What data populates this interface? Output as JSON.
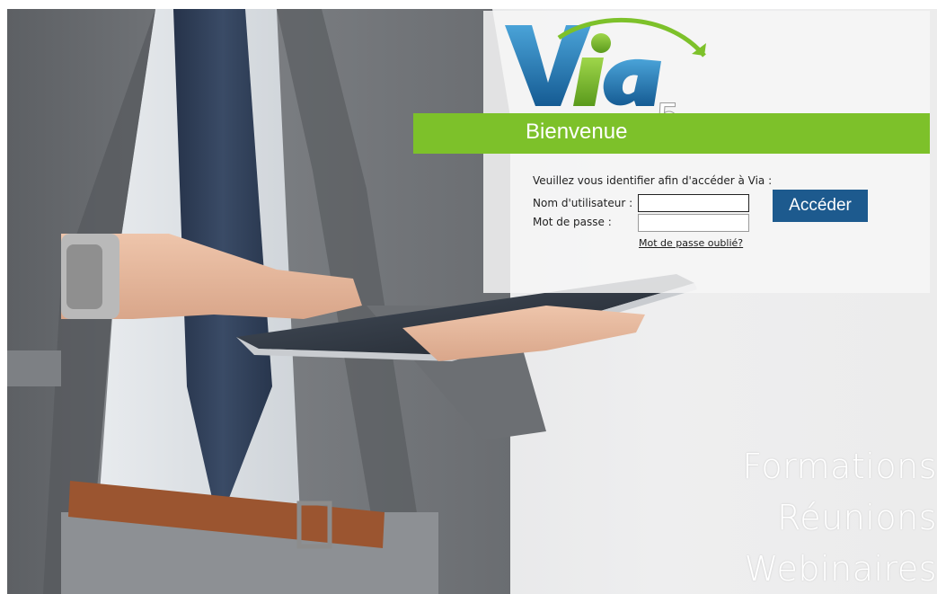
{
  "brand": {
    "logo_text": "Via",
    "logo_version": "5",
    "green": "#7dc12a",
    "blue": "#1d5a8e"
  },
  "login": {
    "welcome": "Bienvenue",
    "instruction": "Veuillez vous identifier afin d'accéder à Via :",
    "username_label": "Nom d'utilisateur :",
    "username_value": "",
    "password_label": "Mot de passe :",
    "password_value": "",
    "forgot_link": "Mot de passe oublié?",
    "submit_label": "Accéder"
  },
  "tagline": {
    "line1": "Formations",
    "line2": "Réunions",
    "line3": "Webinaires"
  }
}
